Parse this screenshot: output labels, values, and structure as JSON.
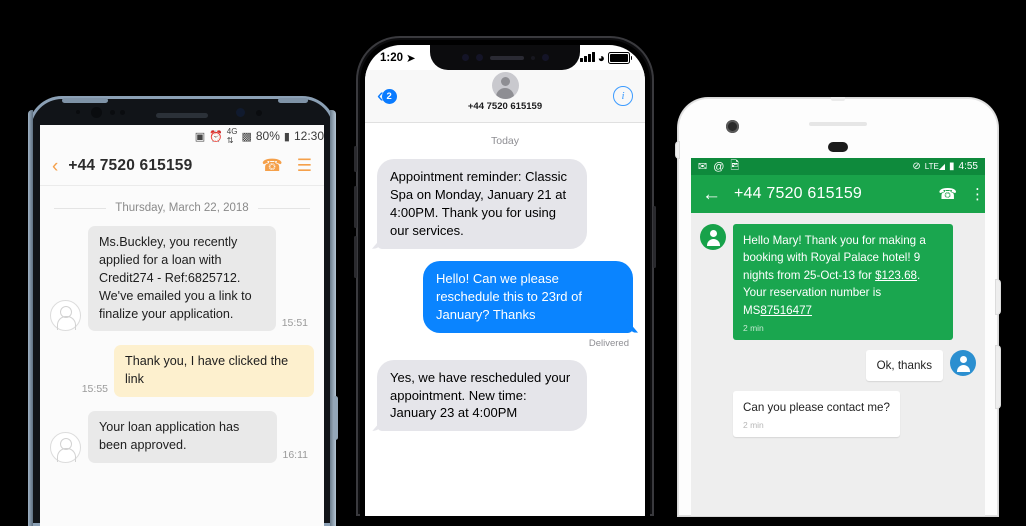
{
  "samsung": {
    "status": {
      "icons": [
        "sim-icon",
        "alarm-icon",
        "4g-icon",
        "signal-icon"
      ],
      "battery": "80%",
      "time": "12:30"
    },
    "header": {
      "back": "‹",
      "title": "+44 7520 615159",
      "call_icon": "call-icon",
      "menu_icon": "menu-icon"
    },
    "date_divider": "Thursday, March 22, 2018",
    "messages": [
      {
        "dir": "in",
        "text": "Ms.Buckley, you recently applied for a loan with Credit274 - Ref:6825712. We've emailed you a link to finalize your application.",
        "time": "15:51"
      },
      {
        "dir": "out",
        "text": "Thank you, I have clicked the link",
        "time": "15:55"
      },
      {
        "dir": "in",
        "text": "Your loan application has been approved.",
        "time": "16:11"
      }
    ]
  },
  "iphone": {
    "status": {
      "time": "1:20",
      "location_icon": "location-arrow-icon",
      "signal_icon": "signal-bars-icon",
      "wifi_icon": "wifi-icon",
      "battery_icon": "battery-icon"
    },
    "nav": {
      "back_icon": "chevron-left-icon",
      "unread_badge": "2",
      "contact": "+44 7520 615159",
      "info_icon": "info-icon"
    },
    "today_label": "Today",
    "messages": [
      {
        "dir": "in",
        "text": "Appointment reminder: Classic Spa on Monday, January 21 at 4:00PM. Thank you for using our services."
      },
      {
        "dir": "out",
        "text": "Hello! Can we please reschedule this to 23rd of January? Thanks",
        "status": "Delivered"
      },
      {
        "dir": "in",
        "text": "Yes, we have rescheduled your appointment. New time: January 23 at 4:00PM"
      }
    ]
  },
  "android": {
    "status": {
      "icons": [
        "mail-icon",
        "at-icon",
        "image-icon"
      ],
      "dnd_icon": "do-not-disturb-icon",
      "lte_icon": "lte-signal-icon",
      "battery_icon": "battery-icon",
      "time": "4:55"
    },
    "appbar": {
      "back_icon": "arrow-back-icon",
      "title": "+44 7520 615159",
      "call_icon": "call-icon",
      "overflow_icon": "more-vert-icon"
    },
    "messages": [
      {
        "dir": "in",
        "style": "green",
        "text_parts": [
          {
            "t": "Hello Mary! Thank you for making a booking with Royal Palace hotel! 9 nights from 25-Oct-13 for ",
            "link": false
          },
          {
            "t": "$123.68",
            "link": true
          },
          {
            "t": ". Your reservation number is MS",
            "link": false
          },
          {
            "t": "87516477",
            "link": true
          }
        ],
        "stamp": "2 min"
      },
      {
        "dir": "out",
        "style": "white",
        "text": "Ok, thanks",
        "stamp": ""
      },
      {
        "dir": "in2",
        "style": "white",
        "text": "Can you please contact me?",
        "stamp": "2 min"
      }
    ]
  }
}
